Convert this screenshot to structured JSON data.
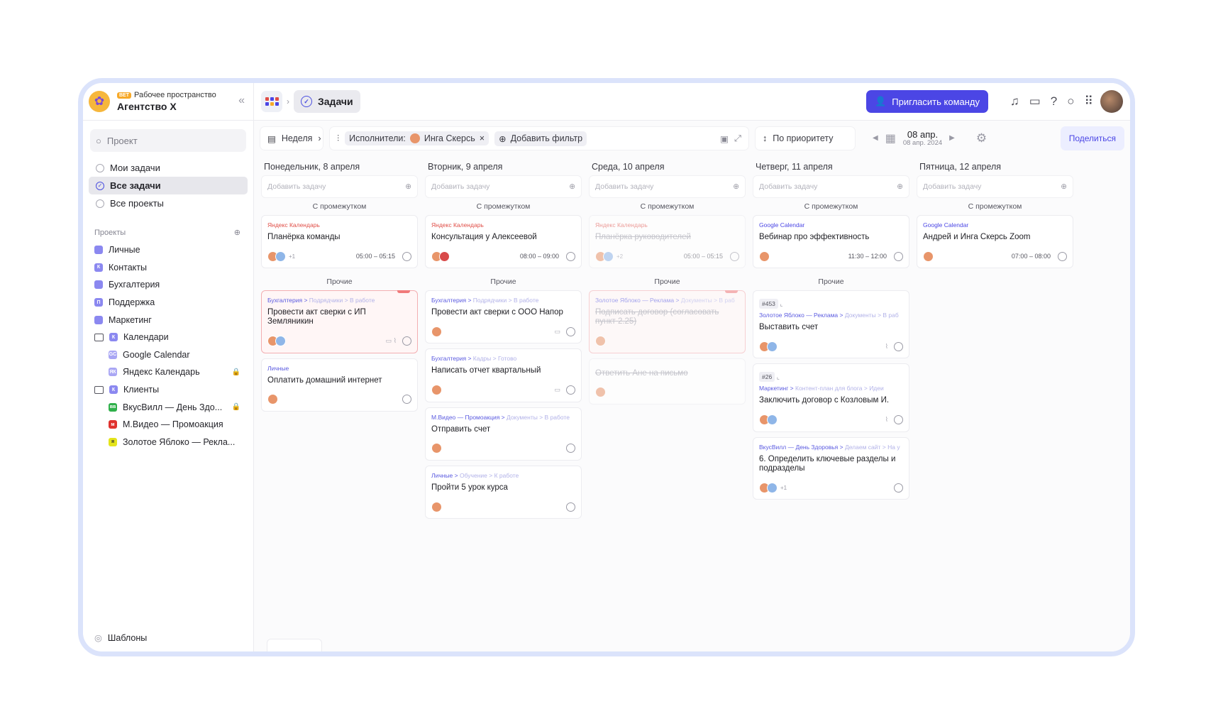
{
  "workspace": {
    "tag": "ВЕТ",
    "label": "Рабочее пространство",
    "name": "Агентство X"
  },
  "sidebar": {
    "search_placeholder": "Проект",
    "nav": [
      {
        "label": "Мои задачи"
      },
      {
        "label": "Все задачи",
        "active": true
      },
      {
        "label": "Все проекты"
      }
    ],
    "projects_title": "Проекты",
    "projects": [
      {
        "label": "Личные",
        "color": "#8b88f0",
        "letter": ""
      },
      {
        "label": "Контакты",
        "color": "#8b88f0",
        "letter": "К"
      },
      {
        "label": "Бухгалтерия",
        "color": "#8b88f0",
        "letter": ""
      },
      {
        "label": "Поддержка",
        "color": "#8b88f0",
        "letter": "П"
      },
      {
        "label": "Маркетинг",
        "color": "#8b88f0",
        "letter": ""
      },
      {
        "label": "Календари",
        "color": "#8b88f0",
        "letter": "К",
        "folder": true
      },
      {
        "label": "Google Calendar",
        "color": "#a9a6f4",
        "letter": "GC",
        "sub": true
      },
      {
        "label": "Яндекс Календарь",
        "color": "#a9a6f4",
        "letter": "ЯК",
        "sub": true,
        "locked": true
      },
      {
        "label": "Клиенты",
        "color": "#8b88f0",
        "letter": "К",
        "folder": true
      },
      {
        "label": "ВкусВилл — День Здо...",
        "color": "#2fb04a",
        "letter": "вв",
        "sub": true,
        "locked": true
      },
      {
        "label": "М.Видео — Промоакция",
        "color": "#e0322e",
        "letter": "м",
        "sub": true
      },
      {
        "label": "Золотое Яблоко — Рекла...",
        "color": "#e4e41a",
        "letter": "я",
        "sub": true
      }
    ],
    "templates": "Шаблоны"
  },
  "topbar": {
    "page": "Задачи",
    "invite": "Пригласить команду"
  },
  "filters": {
    "view": "Неделя",
    "assignees_label": "Исполнители:",
    "assignee": "Инга Скерсь",
    "add_filter": "Добавить фильтр",
    "sort": "По приоритету",
    "date_main": "08 апр.",
    "date_sub": "08 апр. 2024",
    "share": "Поделиться"
  },
  "board": {
    "add_placeholder": "Добавить задачу",
    "group_timed": "С промежутком",
    "group_other": "Прочие",
    "columns": [
      {
        "title": "Понедельник, 8 апреля",
        "timed": [
          {
            "src": "Яндекс Календарь",
            "title": "Планёрка команды",
            "start": "05:00",
            "end": "05:15",
            "plus": "+1"
          }
        ],
        "other": [
          {
            "path": "Бухгалтерия >",
            "path2": "Подрядчики",
            "path3": "> В работе",
            "title": "Провести акт сверки с ИП Земляникин"
          },
          {
            "path": "Личные",
            "path2": "",
            "path3": "",
            "title": "Оплатить домашний интернет"
          }
        ]
      },
      {
        "title": "Вторник, 9 апреля",
        "timed": [
          {
            "src": "Яндекс Календарь",
            "title": "Консультация у Алексеевой",
            "start": "08:00",
            "end": "09:00"
          }
        ],
        "other": [
          {
            "path": "Бухгалтерия >",
            "path2": "Подрядчики",
            "path3": "> В работе",
            "title": "Провести акт сверки с ООО Напор"
          },
          {
            "path": "Бухгалтерия >",
            "path2": "Кадры",
            "path3": "> Готово",
            "title": "Написать отчет квартальный"
          },
          {
            "path": "М.Видео — Промоакция >",
            "path2": "Документы",
            "path3": "> В работе",
            "title": "Отправить счет"
          },
          {
            "path": "Личные >",
            "path2": "Обучение",
            "path3": "> К работе",
            "title": "Пройти 5 урок курса"
          }
        ]
      },
      {
        "title": "Среда, 10 апреля",
        "timed": [
          {
            "src": "Яндекс Календарь",
            "title": "Планёрка руководителей",
            "start": "05:00",
            "end": "05:15",
            "plus": "+2"
          }
        ],
        "other": [
          {
            "path": "Золотое Яблоко — Реклама >",
            "path2": "Документы",
            "path3": "> В раб",
            "title": "Подписать договор (согласовать пункт 2.25)"
          },
          {
            "path": "",
            "path2": "",
            "path3": "",
            "title": "Ответить Ане на письмо"
          }
        ]
      },
      {
        "title": "Четверг, 11 апреля",
        "timed": [
          {
            "src": "Google Calendar",
            "title": "Вебинар про эффективность",
            "start": "11:30",
            "end": "12:00"
          }
        ],
        "other": [
          {
            "num": "#453",
            "path": "Золотое Яблоко — Реклама >",
            "path2": "Документы",
            "path3": "> В раб",
            "title": "Выставить счет"
          },
          {
            "num": "#26",
            "path": "Маркетинг >",
            "path2": "Контент-план для блога",
            "path3": "> Идеи",
            "title": "Заключить договор с Козловым И."
          },
          {
            "path": "ВкусВилл — День Здоровья >",
            "path2": "Делаем сайт",
            "path3": "> На у",
            "title": "6. Определить ключевые разделы и подразделы",
            "plus": "+1"
          }
        ]
      },
      {
        "title": "Пятница, 12 апреля",
        "timed": [
          {
            "src": "Google Calendar",
            "title": "Андрей и Инга Скерсь Zoom",
            "start": "07:00",
            "end": "08:00"
          }
        ],
        "other": []
      }
    ]
  }
}
